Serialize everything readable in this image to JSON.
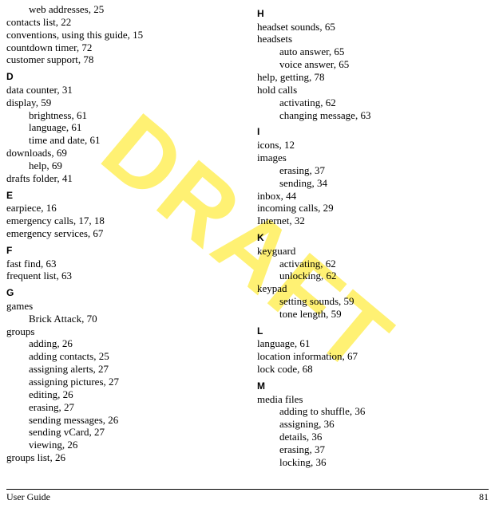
{
  "watermark": "DRAFT",
  "footer": {
    "left": "User Guide",
    "right": "81"
  },
  "columns": [
    {
      "items": [
        {
          "type": "entry",
          "indent": 1,
          "text": "web addresses, 25"
        },
        {
          "type": "entry",
          "indent": 0,
          "text": "contacts list, 22"
        },
        {
          "type": "entry",
          "indent": 0,
          "text": "conventions, using this guide, 15"
        },
        {
          "type": "entry",
          "indent": 0,
          "text": "countdown timer, 72"
        },
        {
          "type": "entry",
          "indent": 0,
          "text": "customer support, 78"
        },
        {
          "type": "letter",
          "text": "D"
        },
        {
          "type": "entry",
          "indent": 0,
          "text": "data counter, 31"
        },
        {
          "type": "entry",
          "indent": 0,
          "text": "display, 59"
        },
        {
          "type": "entry",
          "indent": 1,
          "text": "brightness, 61"
        },
        {
          "type": "entry",
          "indent": 1,
          "text": "language, 61"
        },
        {
          "type": "entry",
          "indent": 1,
          "text": "time and date, 61"
        },
        {
          "type": "entry",
          "indent": 0,
          "text": "downloads, 69"
        },
        {
          "type": "entry",
          "indent": 1,
          "text": "help, 69"
        },
        {
          "type": "entry",
          "indent": 0,
          "text": "drafts folder, 41"
        },
        {
          "type": "letter",
          "text": "E"
        },
        {
          "type": "entry",
          "indent": 0,
          "text": "earpiece, 16"
        },
        {
          "type": "entry",
          "indent": 0,
          "text": "emergency calls, 17, 18"
        },
        {
          "type": "entry",
          "indent": 0,
          "text": "emergency services, 67"
        },
        {
          "type": "letter",
          "text": "F"
        },
        {
          "type": "entry",
          "indent": 0,
          "text": "fast find, 63"
        },
        {
          "type": "entry",
          "indent": 0,
          "text": "frequent list, 63"
        },
        {
          "type": "letter",
          "text": "G"
        },
        {
          "type": "entry",
          "indent": 0,
          "text": "games"
        },
        {
          "type": "entry",
          "indent": 1,
          "text": "Brick Attack, 70"
        },
        {
          "type": "entry",
          "indent": 0,
          "text": "groups"
        },
        {
          "type": "entry",
          "indent": 1,
          "text": "adding, 26"
        },
        {
          "type": "entry",
          "indent": 1,
          "text": "adding contacts, 25"
        },
        {
          "type": "entry",
          "indent": 1,
          "text": "assigning alerts, 27"
        },
        {
          "type": "entry",
          "indent": 1,
          "text": "assigning pictures, 27"
        },
        {
          "type": "entry",
          "indent": 1,
          "text": "editing, 26"
        },
        {
          "type": "entry",
          "indent": 1,
          "text": "erasing, 27"
        },
        {
          "type": "entry",
          "indent": 1,
          "text": "sending messages, 26"
        },
        {
          "type": "entry",
          "indent": 1,
          "text": "sending vCard, 27"
        },
        {
          "type": "entry",
          "indent": 1,
          "text": "viewing, 26"
        },
        {
          "type": "entry",
          "indent": 0,
          "text": "groups list, 26"
        }
      ]
    },
    {
      "items": [
        {
          "type": "letter",
          "text": "H"
        },
        {
          "type": "entry",
          "indent": 0,
          "text": "headset sounds, 65"
        },
        {
          "type": "entry",
          "indent": 0,
          "text": "headsets"
        },
        {
          "type": "entry",
          "indent": 1,
          "text": "auto answer, 65"
        },
        {
          "type": "entry",
          "indent": 1,
          "text": "voice answer, 65"
        },
        {
          "type": "entry",
          "indent": 0,
          "text": "help, getting, 78"
        },
        {
          "type": "entry",
          "indent": 0,
          "text": "hold calls"
        },
        {
          "type": "entry",
          "indent": 1,
          "text": "activating, 62"
        },
        {
          "type": "entry",
          "indent": 1,
          "text": "changing message, 63"
        },
        {
          "type": "letter",
          "text": "I"
        },
        {
          "type": "entry",
          "indent": 0,
          "text": "icons, 12"
        },
        {
          "type": "entry",
          "indent": 0,
          "text": "images"
        },
        {
          "type": "entry",
          "indent": 1,
          "text": "erasing, 37"
        },
        {
          "type": "entry",
          "indent": 1,
          "text": "sending, 34"
        },
        {
          "type": "entry",
          "indent": 0,
          "text": "inbox, 44"
        },
        {
          "type": "entry",
          "indent": 0,
          "text": "incoming calls, 29"
        },
        {
          "type": "entry",
          "indent": 0,
          "text": "Internet, 32"
        },
        {
          "type": "letter",
          "text": "K"
        },
        {
          "type": "entry",
          "indent": 0,
          "text": "keyguard"
        },
        {
          "type": "entry",
          "indent": 1,
          "text": "activating, 62"
        },
        {
          "type": "entry",
          "indent": 1,
          "text": "unlocking, 62"
        },
        {
          "type": "entry",
          "indent": 0,
          "text": "keypad"
        },
        {
          "type": "entry",
          "indent": 1,
          "text": "setting sounds, 59"
        },
        {
          "type": "entry",
          "indent": 1,
          "text": "tone length, 59"
        },
        {
          "type": "letter",
          "text": "L"
        },
        {
          "type": "entry",
          "indent": 0,
          "text": "language, 61"
        },
        {
          "type": "entry",
          "indent": 0,
          "text": "location information, 67"
        },
        {
          "type": "entry",
          "indent": 0,
          "text": "lock code, 68"
        },
        {
          "type": "letter",
          "text": "M"
        },
        {
          "type": "entry",
          "indent": 0,
          "text": "media files"
        },
        {
          "type": "entry",
          "indent": 1,
          "text": "adding to shuffle, 36"
        },
        {
          "type": "entry",
          "indent": 1,
          "text": "assigning, 36"
        },
        {
          "type": "entry",
          "indent": 1,
          "text": "details, 36"
        },
        {
          "type": "entry",
          "indent": 1,
          "text": "erasing, 37"
        },
        {
          "type": "entry",
          "indent": 1,
          "text": "locking, 36"
        }
      ]
    }
  ]
}
